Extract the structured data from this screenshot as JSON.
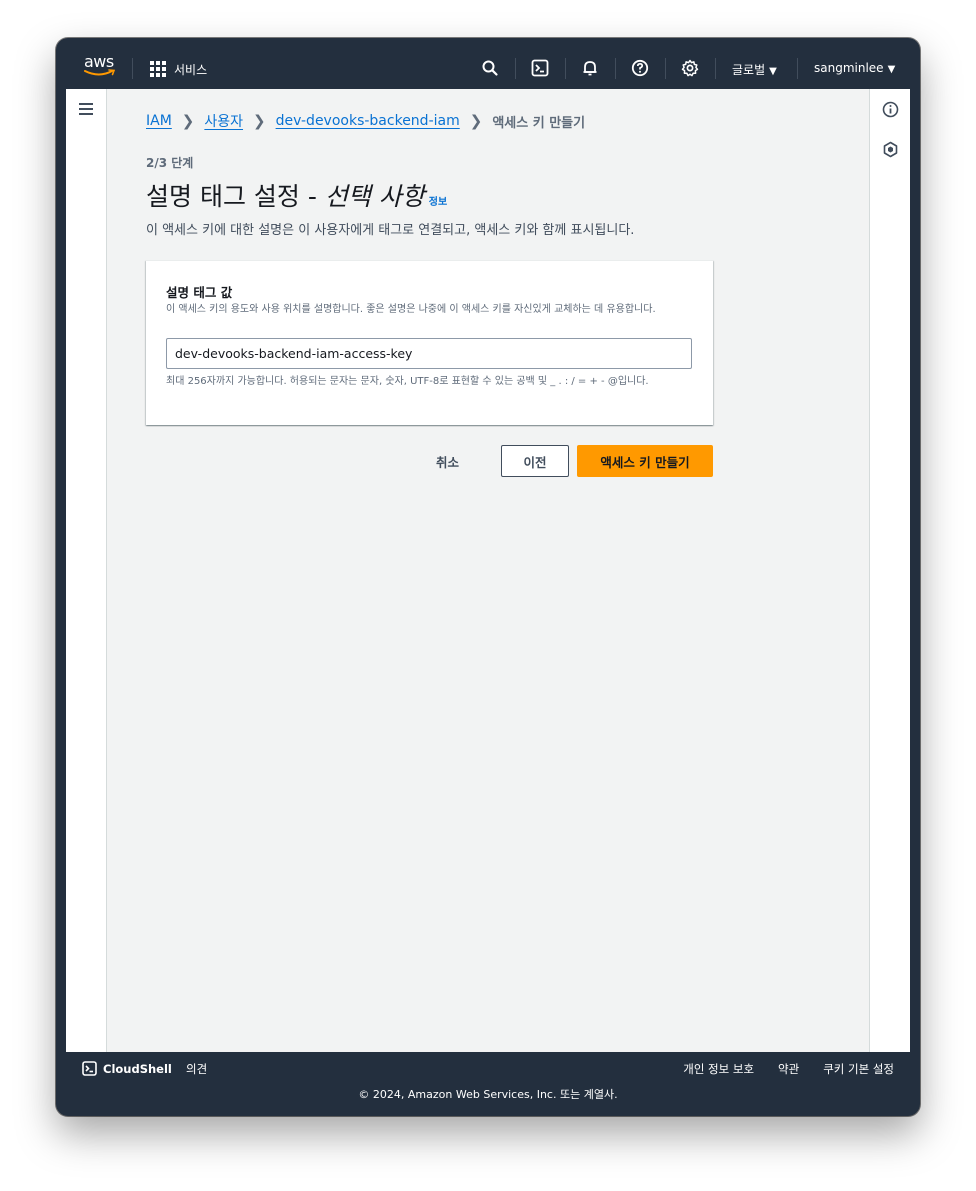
{
  "nav": {
    "logo": "aws",
    "services_label": "서비스",
    "region_label": "글로벌",
    "user_label": "sangminlee",
    "caret": "▼"
  },
  "breadcrumb": {
    "items": [
      "IAM",
      "사용자",
      "dev-devooks-backend-iam"
    ],
    "current": "액세스 키 만들기",
    "separator": "❯"
  },
  "page": {
    "step": "2/3 단계",
    "title": "설명 태그 설정 - ",
    "title_optional": "선택 사항",
    "info_link": "정보",
    "description": "이 액세스 키에 대한 설명은 이 사용자에게 태그로 연결되고, 액세스 키와 함께 표시됩니다."
  },
  "form": {
    "label": "설명 태그 값",
    "description": "이 액세스 키의 용도와 사용 위치를 설명합니다. 좋은 설명은 나중에 이 액세스 키를 자신있게 교체하는 데 유용합니다.",
    "value": "dev-devooks-backend-iam-access-key",
    "constraint": "최대 256자까지 가능합니다. 허용되는 문자는 문자, 숫자, UTF-8로 표현할 수 있는 공백 및 _ . : / = + - @입니다."
  },
  "actions": {
    "cancel": "취소",
    "previous": "이전",
    "create": "액세스 키 만들기"
  },
  "footer": {
    "cloudshell": "CloudShell",
    "feedback": "의견",
    "links": [
      "개인 정보 보호",
      "약관",
      "쿠키 기본 설정"
    ],
    "copyright": "© 2024, Amazon Web Services, Inc. 또는 계열사."
  },
  "colors": {
    "nav_bg": "#232f3e",
    "link": "#0972d3",
    "primary_button": "#ff9900",
    "page_bg": "#f2f3f3"
  }
}
